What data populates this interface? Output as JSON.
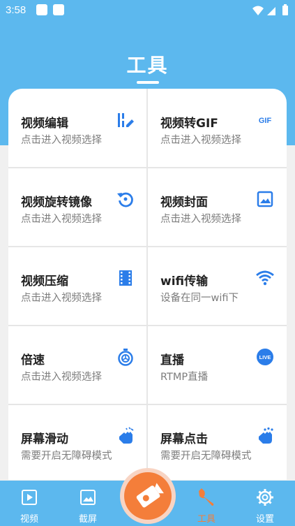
{
  "status_bar": {
    "time": "3:58"
  },
  "header": {
    "title": "工具"
  },
  "tools": [
    {
      "name": "视频编辑",
      "desc": "点击进入视频选择",
      "icon": "video-edit-icon"
    },
    {
      "name": "视频转GIF",
      "desc": "点击进入视频选择",
      "icon": "gif-icon",
      "icon_text": "GIF"
    },
    {
      "name": "视频旋转镜像",
      "desc": "点击进入视频选择",
      "icon": "rotate-icon"
    },
    {
      "name": "视频封面",
      "desc": "点击进入视频选择",
      "icon": "image-icon"
    },
    {
      "name": "视频压缩",
      "desc": "点击进入视频选择",
      "icon": "film-icon"
    },
    {
      "name": "wifi传输",
      "desc": "设备在同一wifi下",
      "icon": "wifi-icon"
    },
    {
      "name": "倍速",
      "desc": "点击进入视频选择",
      "icon": "speed-icon"
    },
    {
      "name": "直播",
      "desc": "RTMP直播",
      "icon": "live-icon",
      "icon_text": "LIVE"
    },
    {
      "name": "屏幕滑动",
      "desc": "需要开启无障碍模式",
      "icon": "swipe-hand-icon"
    },
    {
      "name": "屏幕点击",
      "desc": "需要开启无障碍模式",
      "icon": "tap-hand-icon"
    }
  ],
  "bottom_nav": [
    {
      "label": "视频",
      "icon": "video-icon",
      "active": false
    },
    {
      "label": "截屏",
      "icon": "screenshot-icon",
      "active": false
    },
    {
      "label": "工具",
      "icon": "wrench-icon",
      "active": true
    },
    {
      "label": "设置",
      "icon": "gear-icon",
      "active": false
    }
  ],
  "colors": {
    "primary": "#5cb8ee",
    "icon_blue": "#2b7de9",
    "accent": "#f47e3a"
  }
}
